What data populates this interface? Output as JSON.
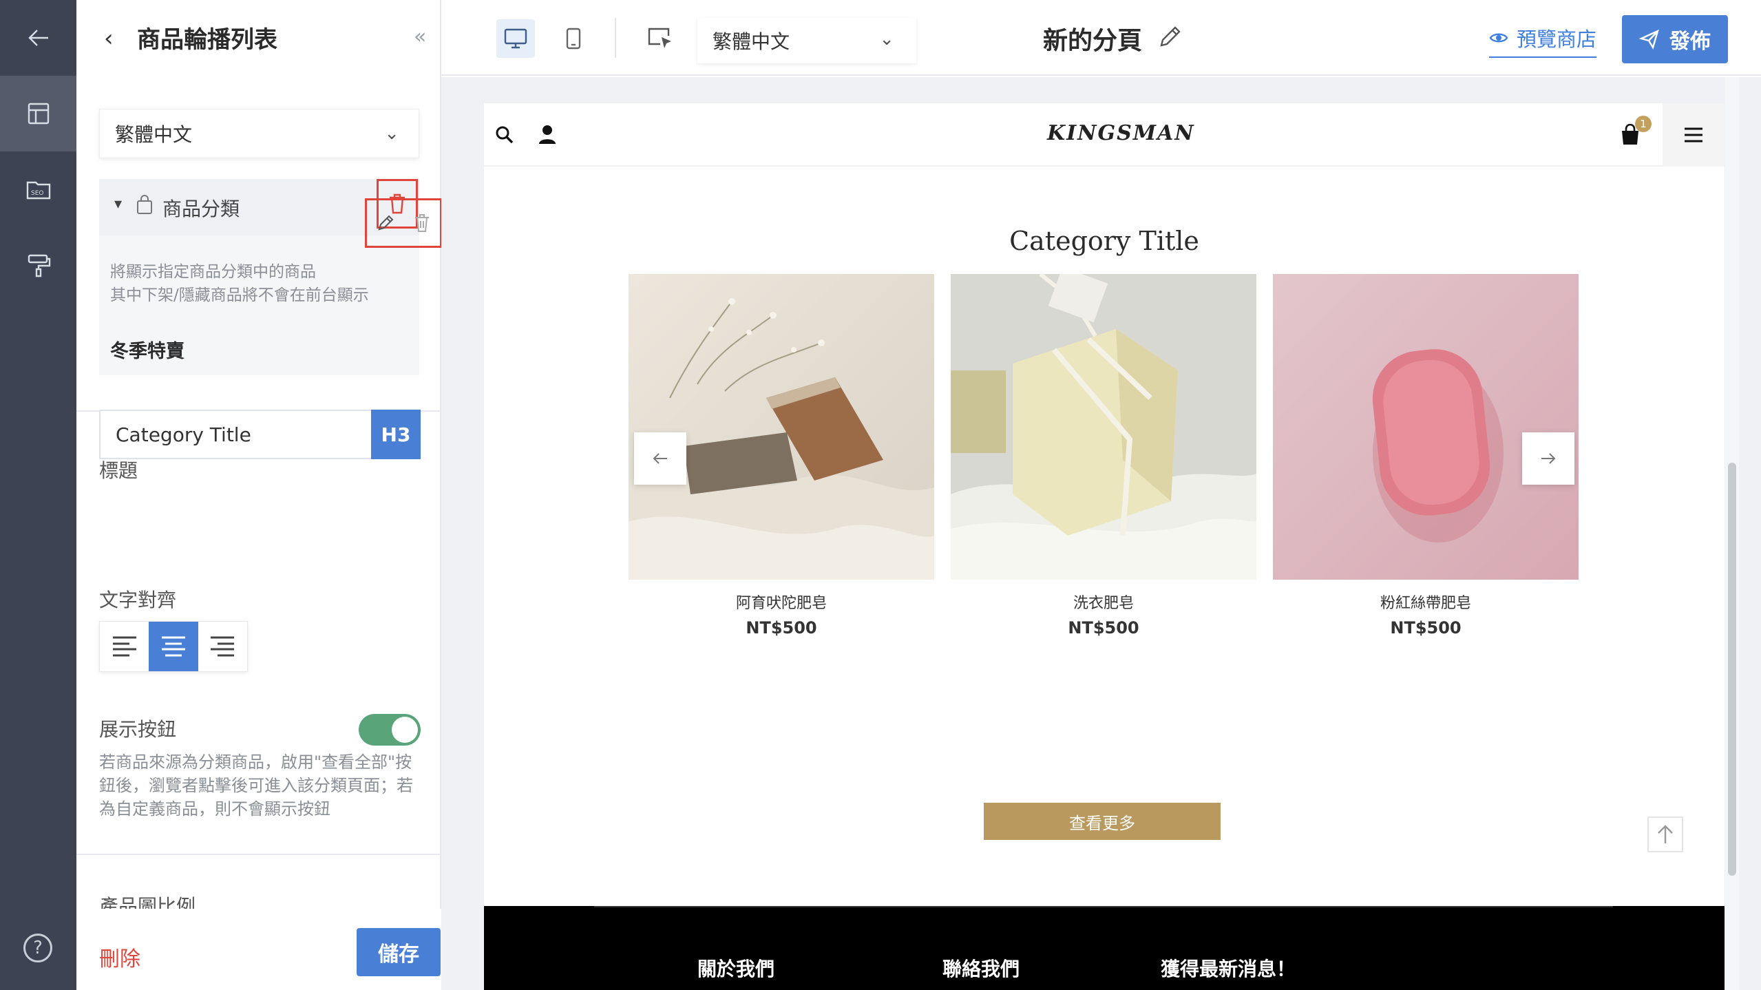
{
  "panel": {
    "title": "商品輪播列表",
    "language_select": "繁體中文",
    "category": {
      "label": "商品分類",
      "description_line1": "將顯示指定商品分類中的商品",
      "description_line2": "其中下架/隱藏商品將不會在前台顯示",
      "item": "冬季特賣"
    },
    "title_field": {
      "label": "標題",
      "value": "Category Title",
      "heading_level": "H3"
    },
    "text_align": {
      "label": "文字對齊",
      "selected": "center"
    },
    "show_button": {
      "label": "展示按鈕",
      "enabled": true,
      "description": "若商品來源為分類商品，啟用\"查看全部\"按鈕後，瀏覽者點擊後可進入該分類頁面；若為自定義商品，則不會顯示按鈕"
    },
    "image_ratio_label": "產品圖比例",
    "delete_label": "刪除",
    "save_label": "儲存"
  },
  "toolbar": {
    "language_select": "繁體中文",
    "page_name": "新的分頁",
    "preview_label": "預覽商店",
    "publish_label": "發佈"
  },
  "site": {
    "brand": "KINGSMAN",
    "cart_count": "1",
    "section_title": "Category Title",
    "products": [
      {
        "name": "阿育吠陀肥皂",
        "price": "NT$500"
      },
      {
        "name": "洗衣肥皂",
        "price": "NT$500"
      },
      {
        "name": "粉紅絲帶肥皂",
        "price": "NT$500"
      }
    ],
    "more_button": "查看更多",
    "footer_links": [
      "關於我們",
      "聯絡我們",
      "獲得最新消息！"
    ]
  },
  "colors": {
    "accent": "#4a7fd6",
    "danger": "#e0453c",
    "toggle_on": "#5aa47a",
    "gold": "#b9995d",
    "rail": "#3d4353"
  }
}
